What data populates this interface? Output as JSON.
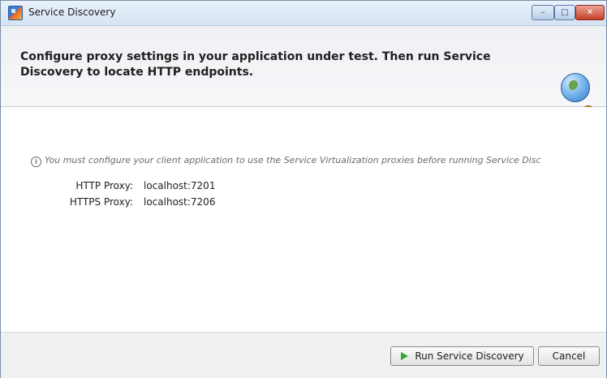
{
  "window": {
    "title": "Service Discovery",
    "controls": {
      "minimize": "–",
      "maximize": "□",
      "close": "✕"
    }
  },
  "banner": {
    "text": "Configure proxy settings in your application under test. Then run Service Discovery to locate HTTP endpoints.",
    "icon": "globe-gear-icon"
  },
  "info": {
    "icon": "info-icon",
    "icon_glyph": "i",
    "text": "You must configure your client application to use the Service Virtualization proxies before running Service Disc"
  },
  "proxies": [
    {
      "label": "HTTP Proxy:",
      "value": "localhost:7201"
    },
    {
      "label": "HTTPS Proxy:",
      "value": "localhost:7206"
    }
  ],
  "footer": {
    "run_label": "Run Service Discovery",
    "cancel_label": "Cancel"
  },
  "colors": {
    "titlebar": "#d5e3f3",
    "banner": "#eef0f3",
    "footer": "#f0f0f0",
    "run_icon": "#2ea82e"
  }
}
